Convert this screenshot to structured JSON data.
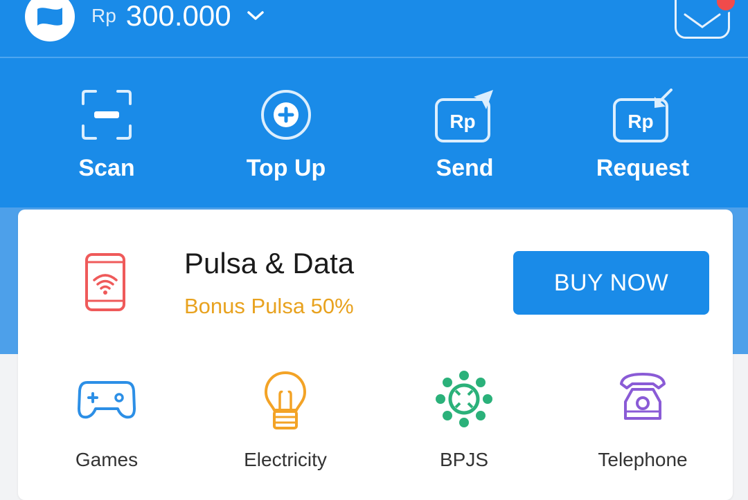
{
  "header": {
    "currency": "Rp",
    "balance": "300.000"
  },
  "actions": [
    {
      "label": "Scan",
      "icon": "scan-icon"
    },
    {
      "label": "Top Up",
      "icon": "plus-circle-icon"
    },
    {
      "label": "Send",
      "icon": "send-money-icon"
    },
    {
      "label": "Request",
      "icon": "request-money-icon"
    }
  ],
  "promo": {
    "title": "Pulsa & Data",
    "subtitle": "Bonus Pulsa 50%",
    "button": "BUY NOW",
    "icon": "phone-wifi-icon"
  },
  "services": [
    {
      "label": "Games",
      "icon": "gamepad-icon"
    },
    {
      "label": "Electricity",
      "icon": "lightbulb-icon"
    },
    {
      "label": "BPJS",
      "icon": "bpjs-icon"
    },
    {
      "label": "Telephone",
      "icon": "telephone-icon"
    }
  ],
  "colors": {
    "primary": "#1a8be8",
    "accent_orange": "#e8a21f",
    "notification": "#f04b4b",
    "icon_red": "#ef5a5a",
    "icon_blue": "#2c8fe6",
    "icon_orange": "#f3a326",
    "icon_green": "#2bb17a",
    "icon_purple": "#8a5bd6"
  }
}
